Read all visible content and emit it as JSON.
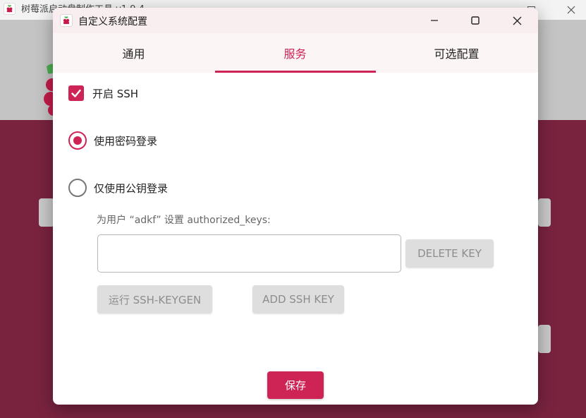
{
  "background_window": {
    "title": "树莓派启动盘制作工具 v1.9.4",
    "colors": {
      "header": "#c4c4c4",
      "body": "#79233f"
    }
  },
  "dialog": {
    "title": "自定义系统配置",
    "tabs": [
      {
        "label": "通用",
        "active": false
      },
      {
        "label": "服务",
        "active": true
      },
      {
        "label": "可选配置",
        "active": false
      }
    ],
    "ssh": {
      "enable_label": "开启 SSH",
      "enabled": true,
      "password_login_label": "使用密码登录",
      "password_login_selected": true,
      "pubkey_login_label": "仅使用公钥登录",
      "pubkey_login_selected": false,
      "authorized_keys_label": "为用户 “adkf” 设置 authorized_keys:",
      "authorized_keys_value": "",
      "delete_key_label": "DELETE KEY",
      "run_keygen_label": "运行 SSH-KEYGEN",
      "add_key_label": "ADD SSH KEY"
    },
    "save_label": "保存"
  },
  "colors": {
    "accent": "#cd2355",
    "titlebar": "#f8eeef",
    "tabbar": "#fcf5f6",
    "disabled_button": "#dedede"
  },
  "icons": {
    "app": "raspberry-icon",
    "minimize": "minimize-icon",
    "maximize": "maximize-icon",
    "close": "close-icon",
    "check": "checkmark-icon"
  }
}
